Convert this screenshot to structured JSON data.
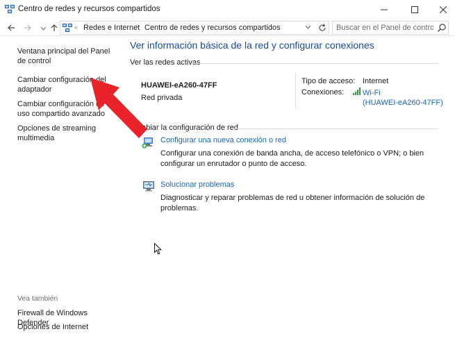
{
  "window": {
    "title": "Centro de redes y recursos compartidos"
  },
  "address": {
    "crumbs": [
      "Redes e Internet",
      "Centro de redes y recursos compartidos"
    ],
    "separator": "›",
    "search_placeholder": "Buscar en el Panel de control"
  },
  "sidebar": {
    "links": [
      "Ventana principal del Panel de control",
      "Cambiar configuración del adaptador",
      "Cambiar configuración de uso compartido avanzado",
      "Opciones de streaming multimedia"
    ],
    "see_also_label": "Vea también",
    "see_also": [
      "Firewall de Windows Defender",
      "Opciones de Internet"
    ]
  },
  "main": {
    "title": "Ver información básica de la red y configurar conexiones",
    "active_networks_label": "Ver las redes activas",
    "network": {
      "name": "HUAWEI-eA260-47FF",
      "type": "Red privada",
      "access_label": "Tipo de acceso:",
      "access_value": "Internet",
      "connections_label": "Conexiones:",
      "connection_name": "Wi-Fi",
      "connection_ssid": "(HUAWEI-eA260-47FF)"
    },
    "change_settings_label": "Cambiar la configuración de red",
    "tasks": [
      {
        "label": "Configurar una nueva conexión o red",
        "description": "Configurar una conexión de banda ancha, de acceso telefónico o VPN; o bien configurar un enrutador o punto de acceso.",
        "icon": "new-connection-icon"
      },
      {
        "label": "Solucionar problemas",
        "description": "Diagnosticar y reparar problemas de red u obtener información de solución de problemas.",
        "icon": "troubleshoot-icon"
      }
    ]
  },
  "colors": {
    "title_blue": "#1a4a9c",
    "link_blue": "#1a66c0",
    "annotation_arrow": "#e8232a"
  }
}
